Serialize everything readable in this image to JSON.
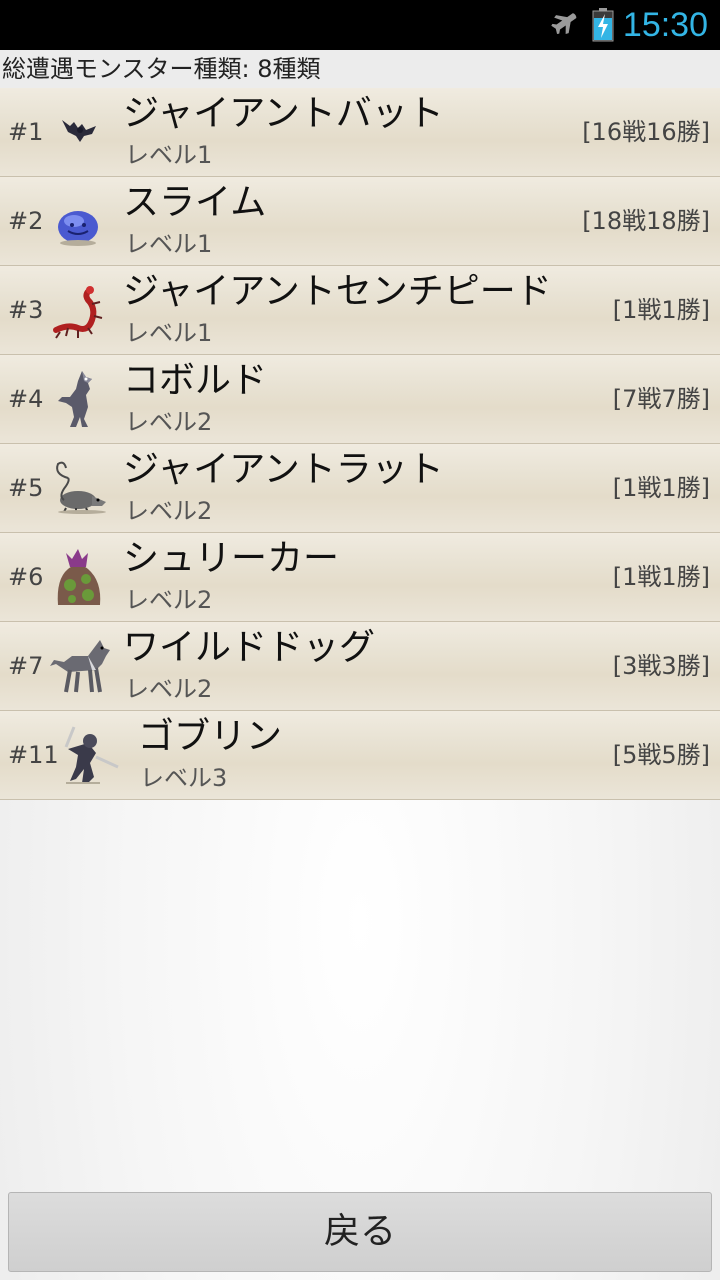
{
  "status_bar": {
    "time": "15:30",
    "icons": [
      "airplane-mode-icon",
      "battery-charging-icon"
    ],
    "clock_color": "#33b5e5"
  },
  "header": {
    "summary": "総遭遇モンスター種類: 8種類"
  },
  "monsters": [
    {
      "num": "#1",
      "name": "ジャイアントバット",
      "level": "レベル1",
      "record": "[16戦16勝]",
      "icon": "bat-sprite"
    },
    {
      "num": "#2",
      "name": "スライム",
      "level": "レベル1",
      "record": "[18戦18勝]",
      "icon": "slime-sprite"
    },
    {
      "num": "#3",
      "name": "ジャイアントセンチピード",
      "level": "レベル1",
      "record": "[1戦1勝]",
      "icon": "centipede-sprite"
    },
    {
      "num": "#4",
      "name": "コボルド",
      "level": "レベル2",
      "record": "[7戦7勝]",
      "icon": "kobold-sprite"
    },
    {
      "num": "#5",
      "name": "ジャイアントラット",
      "level": "レベル2",
      "record": "[1戦1勝]",
      "icon": "rat-sprite"
    },
    {
      "num": "#6",
      "name": "シュリーカー",
      "level": "レベル2",
      "record": "[1戦1勝]",
      "icon": "shrieker-sprite"
    },
    {
      "num": "#7",
      "name": "ワイルドドッグ",
      "level": "レベル2",
      "record": "[3戦3勝]",
      "icon": "wild-dog-sprite"
    },
    {
      "num": "#11",
      "name": "ゴブリン",
      "level": "レベル3",
      "record": "[5戦5勝]",
      "icon": "goblin-sprite"
    }
  ],
  "footer": {
    "back_label": "戻る"
  }
}
